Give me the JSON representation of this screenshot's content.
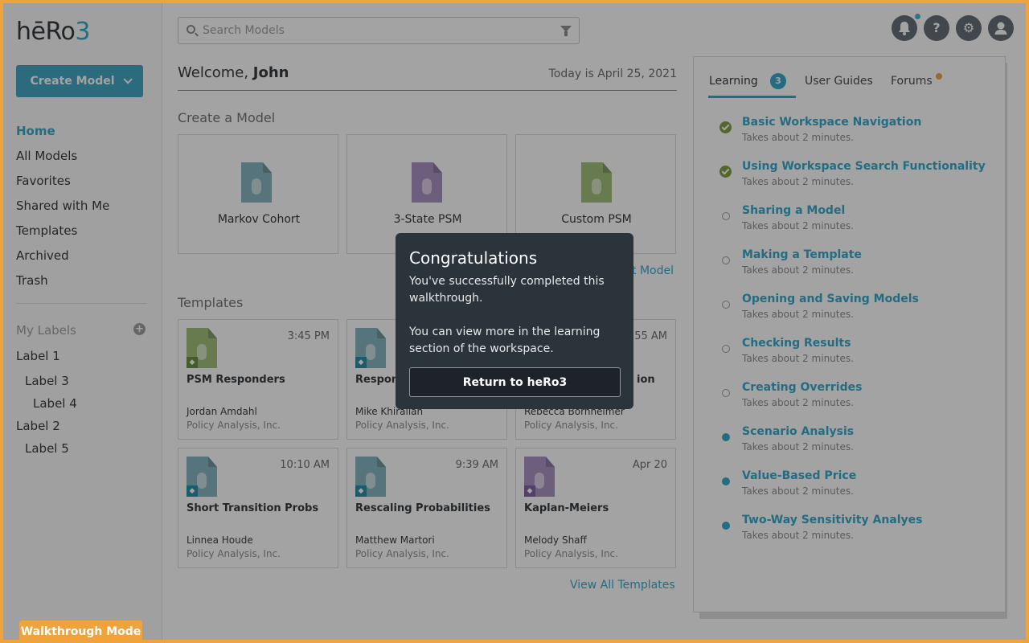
{
  "app": {
    "logo_main": "hēRo",
    "logo_num": "3"
  },
  "sidebar": {
    "create_label": "Create Model",
    "nav": [
      "Home",
      "All Models",
      "Favorites",
      "Shared with Me",
      "Templates",
      "Archived",
      "Trash"
    ],
    "labels_title": "My Labels",
    "labels": [
      {
        "name": "Label 1",
        "level": 0
      },
      {
        "name": "Label 3",
        "level": 1
      },
      {
        "name": "Label 4",
        "level": 2
      },
      {
        "name": "Label 2",
        "level": 0
      },
      {
        "name": "Label 5",
        "level": 1
      }
    ]
  },
  "search": {
    "placeholder": "Search Models",
    "value": ""
  },
  "header": {
    "welcome_prefix": "Welcome, ",
    "user": "John",
    "date": "Today is April 25, 2021"
  },
  "create_section": {
    "title": "Create a Model",
    "cards": [
      {
        "name": "Markov Cohort",
        "color": "#7fb1be"
      },
      {
        "name": "3-State PSM",
        "color": "#a68cc2"
      },
      {
        "name": "Custom PSM",
        "color": "#9cbc72"
      }
    ],
    "import_label": "t Model"
  },
  "templates": {
    "title": "Templates",
    "items": [
      {
        "name": "PSM Responders",
        "time": "3:45 PM",
        "author": "Jordan Amdahl",
        "org": "Policy Analysis, Inc.",
        "color": "#9cbc72",
        "badge": "#5f8c36"
      },
      {
        "name": "Respon",
        "time": "",
        "author": "Mike Khirallah",
        "org": "Policy Analysis, Inc.",
        "color": "#7fb1be",
        "badge": "#1b87a3"
      },
      {
        "name": "ion",
        "time": "55 AM",
        "author": "Rebecca Bornheimer",
        "org": "Policy Analysis, Inc.",
        "color": "",
        "badge": ""
      },
      {
        "name": "Short Transition Probs",
        "time": "10:10 AM",
        "author": "Linnea Houde",
        "org": "Policy Analysis, Inc.",
        "color": "#7fb1be",
        "badge": "#1b87a3"
      },
      {
        "name": "Rescaling Probabilities",
        "time": "9:39 AM",
        "author": "Matthew Martori",
        "org": "Policy Analysis, Inc.",
        "color": "#7fb1be",
        "badge": "#1b87a3"
      },
      {
        "name": "Kaplan-Meiers",
        "time": "Apr 20",
        "author": "Melody Shaff",
        "org": "Policy Analysis, Inc.",
        "color": "#a68cc2",
        "badge": "#7a5ba0"
      }
    ],
    "view_all": "View All Templates"
  },
  "panel": {
    "tabs": {
      "learning": "Learning",
      "learning_count": "3",
      "guides": "User Guides",
      "forums": "Forums"
    },
    "lessons": [
      {
        "title": "Basic Workspace Navigation",
        "sub": "Takes about 2 minutes.",
        "status": "done"
      },
      {
        "title": "Using Workspace Search Functionality",
        "sub": "Takes about 2 minutes.",
        "status": "done"
      },
      {
        "title": "Sharing a Model",
        "sub": "Takes about 2 minutes.",
        "status": "todo"
      },
      {
        "title": "Making a Template",
        "sub": "Takes about 2 minutes.",
        "status": "todo"
      },
      {
        "title": "Opening and Saving Models",
        "sub": "Takes about 2 minutes.",
        "status": "todo"
      },
      {
        "title": "Checking Results",
        "sub": "Takes about 2 minutes.",
        "status": "todo"
      },
      {
        "title": "Creating Overrides",
        "sub": "Takes about 2 minutes.",
        "status": "todo"
      },
      {
        "title": "Scenario Analysis",
        "sub": "Takes about 2 minutes.",
        "status": "locked"
      },
      {
        "title": "Value-Based Price",
        "sub": "Takes about 2 minutes.",
        "status": "locked"
      },
      {
        "title": "Two-Way Sensitivity Analyes",
        "sub": "Takes about 2 minutes.",
        "status": "locked"
      }
    ]
  },
  "modal": {
    "title": "Congratulations",
    "text1": "You've successfully completed this walkthrough.",
    "text2": "You can view more in the learning section of the workspace.",
    "button": "Return to heRo3"
  },
  "walkthrough_badge": "Walkthrough Mode",
  "top_icons": {
    "help": "?",
    "settings": "⚙",
    "user": "●"
  }
}
